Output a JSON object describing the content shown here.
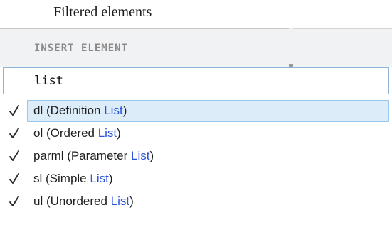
{
  "caption": "Filtered elements",
  "panel": {
    "header_label": "INSERT ELEMENT"
  },
  "search": {
    "value": "list"
  },
  "icons": {
    "item_marker": "checkmark-icon"
  },
  "colors": {
    "match_highlight": "#2a52d9",
    "selected_row_bg": "#dcecf9",
    "selected_row_border": "#9cc7ec",
    "search_border": "#8fb4d8"
  },
  "items": [
    {
      "prefix": "dl (Definition ",
      "match": "List",
      "suffix": ")",
      "selected": true
    },
    {
      "prefix": "ol (Ordered ",
      "match": "List",
      "suffix": ")",
      "selected": false
    },
    {
      "prefix": "parml (Parameter ",
      "match": "List",
      "suffix": ")",
      "selected": false
    },
    {
      "prefix": "sl (Simple ",
      "match": "List",
      "suffix": ")",
      "selected": false
    },
    {
      "prefix": "ul (Unordered ",
      "match": "List",
      "suffix": ")",
      "selected": false
    }
  ]
}
